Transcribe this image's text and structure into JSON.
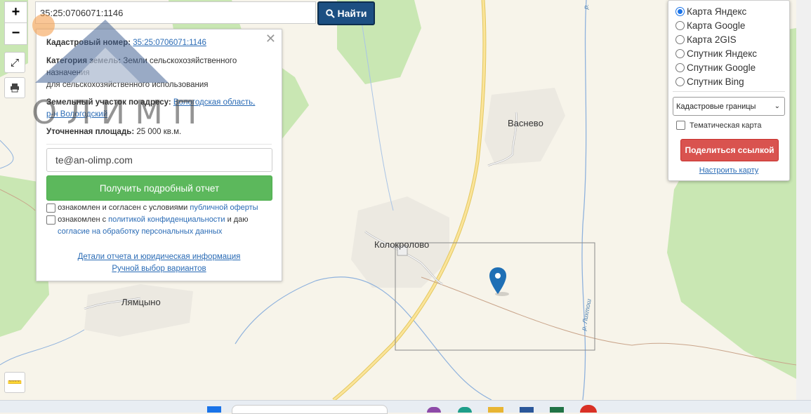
{
  "search": {
    "value": "35:25:0706071:1146",
    "button_label": "Найти"
  },
  "zoom": {
    "in": "+",
    "out": "−"
  },
  "info": {
    "cadastral_label": "Кадастровый номер:",
    "cadastral_value": "35:25:0706071:1146",
    "category_label": "Категория земель:",
    "category_value_1": "Земли сельскохозяйственного",
    "category_value_2": "назначения",
    "category_value_3": "для сельскохозяйственного использования",
    "address_label": "Земельный участок по адресу:",
    "address_value_1": "Вологодская область,",
    "address_value_2": "р-н Вологодский",
    "area_label": "Уточненная площадь:",
    "area_value": "25 000 кв.м.",
    "email_value": "te@an-olimp.com",
    "report_button": "Получить подробный отчет",
    "agree1_prefix": "ознакомлен и согласен с условиями",
    "agree1_link": "публичной оферты",
    "agree2_prefix": "ознакомлен с",
    "agree2_link": "политикой конфиденциальности",
    "agree2_mid": "и даю",
    "agree2_link2": "согласие на обработку персональных данных",
    "details_link": "Детали отчета и юридическая информация",
    "manual_link": "Ручной выбор вариантов",
    "logo_text": "ОЛИМП"
  },
  "layers": {
    "options": [
      "Карта Яндекс",
      "Карта Google",
      "Карта 2GIS",
      "Спутник Яндекс",
      "Спутник Google",
      "Спутник Bing"
    ],
    "selected": "Карта Яндекс",
    "overlay_select": "Кадастровые границы",
    "thematic_label": "Тематическая карта",
    "share_button": "Поделиться ссылкой",
    "settings_link": "Настроить карту"
  },
  "map": {
    "places": [
      "Васнево",
      "Колокролово",
      "Лямцыно"
    ],
    "river": "р. Лихтош"
  }
}
